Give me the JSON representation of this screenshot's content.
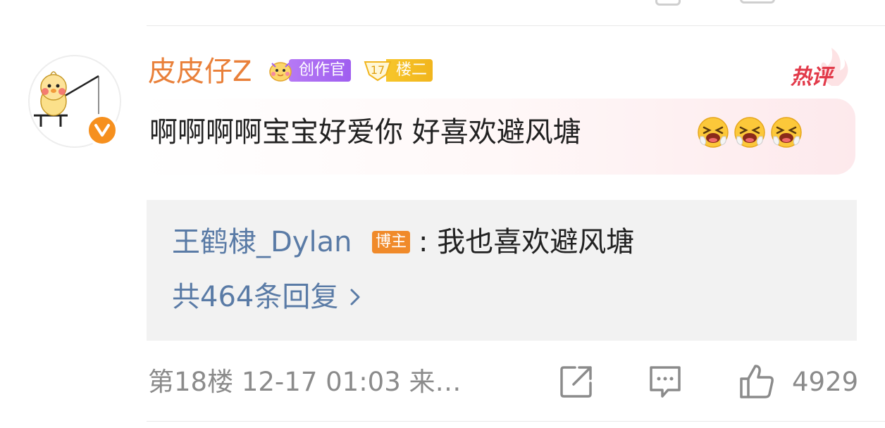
{
  "comment": {
    "username": "皮皮仔Z",
    "creator_badge": "创作官",
    "floor_badge_number": "17",
    "floor_badge_label": "楼二",
    "hot_label": "热评",
    "text": "啊啊啊啊宝宝好爱你 好喜欢避风塘",
    "emojis": [
      "crying-face-icon",
      "crying-face-icon",
      "crying-face-icon"
    ]
  },
  "reply_preview": {
    "user": "王鹤棣_Dylan",
    "author_tag": "博主",
    "text": ": 我也喜欢避风塘",
    "count_label": "共464条回复",
    "chevron": "›"
  },
  "footer": {
    "meta": "第18楼  12-17 01:03  来…",
    "like_count": "4929"
  },
  "colors": {
    "username": "#e9803a",
    "link_blue": "#5a7ba6",
    "creator_purple": "#a767f2",
    "floor_yellow": "#f3b91f",
    "hot_red": "#e23a4a",
    "author_orange": "#f08a2a",
    "meta_gray": "#8b8b8b"
  }
}
